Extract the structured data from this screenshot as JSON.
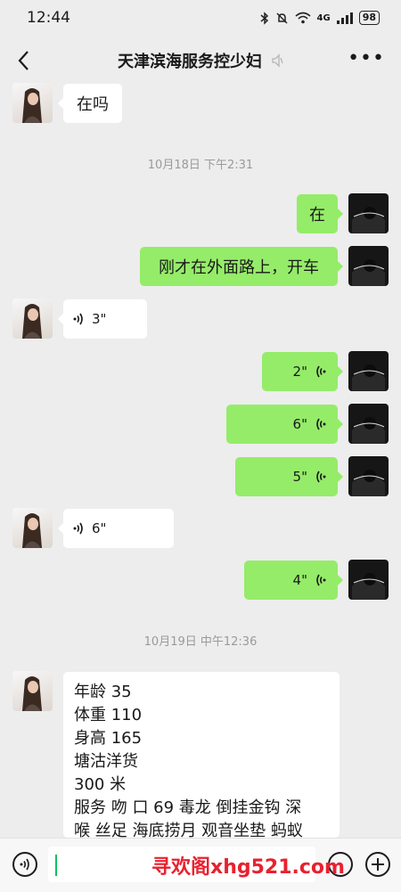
{
  "status_bar": {
    "time": "12:44",
    "network": "4G",
    "battery": "98"
  },
  "header": {
    "title": "天津滨海服务控少妇"
  },
  "messages": {
    "m1": "在吗",
    "ts1": "10月18日 下午2:31",
    "m2": "在",
    "m3": "刚才在外面路上，开车",
    "v1": "3\"",
    "v2": "2\"",
    "v3": "6\"",
    "v4": "5\"",
    "v5": "6\"",
    "v6": "4\"",
    "ts2": "10月19日 中午12:36",
    "m4": "年龄 35\n体重 110\n身高 165\n塘沽洋货\n300 米\n服务 吻 口 69 毒龙  倒挂金钩  深\n喉  丝足  海底捞月 观音坐垫 蚂蚁"
  },
  "input_bar": {
    "value": "",
    "placeholder": ""
  },
  "watermark": "寻欢阁xhg521.com",
  "icons": {
    "back": "back-arrow-icon",
    "mute": "mute-icon",
    "more": "more-icon",
    "voice": "voice-icon",
    "emoji": "emoji-icon",
    "add": "add-icon"
  }
}
